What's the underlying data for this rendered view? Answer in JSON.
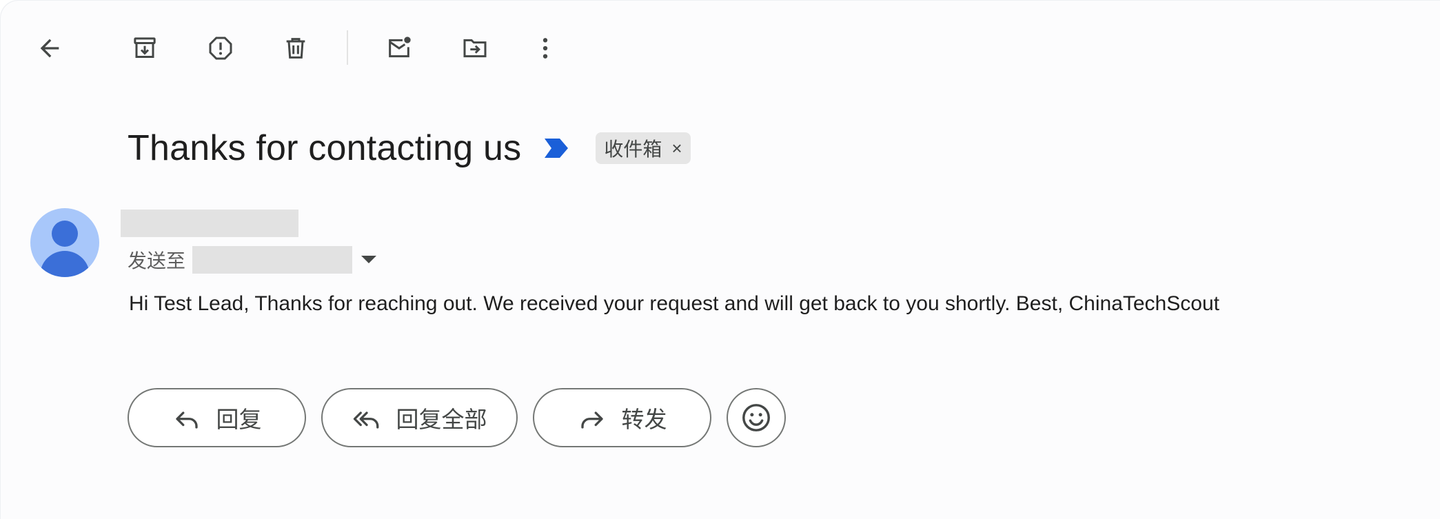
{
  "toolbar": {
    "icons": [
      "back-arrow-icon",
      "archive-icon",
      "report-spam-icon",
      "delete-icon",
      "mark-unread-icon",
      "move-to-icon",
      "more-options-icon"
    ]
  },
  "email": {
    "subject": "Thanks for contacting us",
    "label_chip": "收件箱",
    "label_remove": "×",
    "to_label": "发送至",
    "body": "Hi Test Lead, Thanks for reaching out. We received your request and will get back to you shortly. Best, ChinaTechScout"
  },
  "actions": {
    "reply": "回复",
    "reply_all": "回复全部",
    "forward": "转发"
  },
  "colors": {
    "importance_marker": "#1a5fd8",
    "avatar_bg": "#a8c7fa",
    "avatar_fg": "#3b6fd8",
    "chip_bg": "#e6e6e6"
  }
}
